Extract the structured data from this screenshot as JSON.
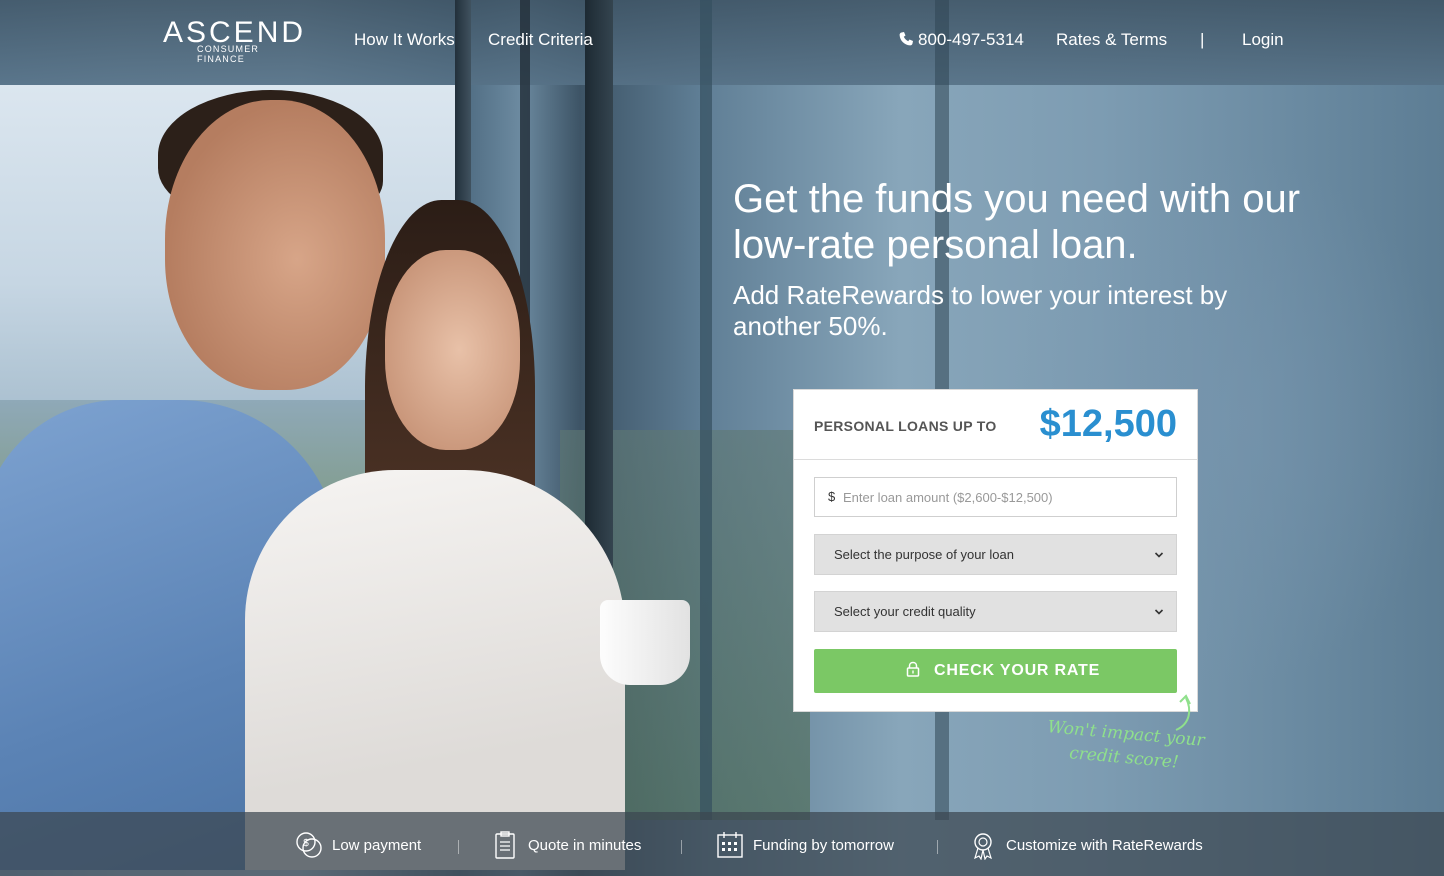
{
  "brand": {
    "name": "ASCEND",
    "tagline": "CONSUMER FINANCE"
  },
  "nav": {
    "how_it_works": "How It Works",
    "credit_criteria": "Credit Criteria",
    "phone": "800-497-5314",
    "rates_terms": "Rates & Terms",
    "separator": "|",
    "login": "Login"
  },
  "hero": {
    "headline": "Get the funds you need with our low-rate personal loan.",
    "subheadline": "Add RateRewards to lower your interest by another 50%."
  },
  "form": {
    "header_label": "PERSONAL LOANS UP TO",
    "max_amount": "$12,500",
    "currency_symbol": "$",
    "amount_value": "",
    "amount_placeholder": "Enter loan amount ($2,600-$12,500)",
    "purpose_select": "Select the purpose of your loan",
    "credit_select": "Select your credit quality",
    "submit_label": "CHECK YOUR RATE",
    "note": "Won't impact your credit score!"
  },
  "features": [
    {
      "label": "Low payment",
      "icon": "coins-icon"
    },
    {
      "label": "Quote in minutes",
      "icon": "clipboard-icon"
    },
    {
      "label": "Funding by tomorrow",
      "icon": "calendar-icon"
    },
    {
      "label": "Customize with RateRewards",
      "icon": "award-badge-icon"
    }
  ],
  "colors": {
    "accent_blue": "#2a8fd0",
    "cta_green": "#7bc865",
    "note_green": "#8fe08c"
  }
}
